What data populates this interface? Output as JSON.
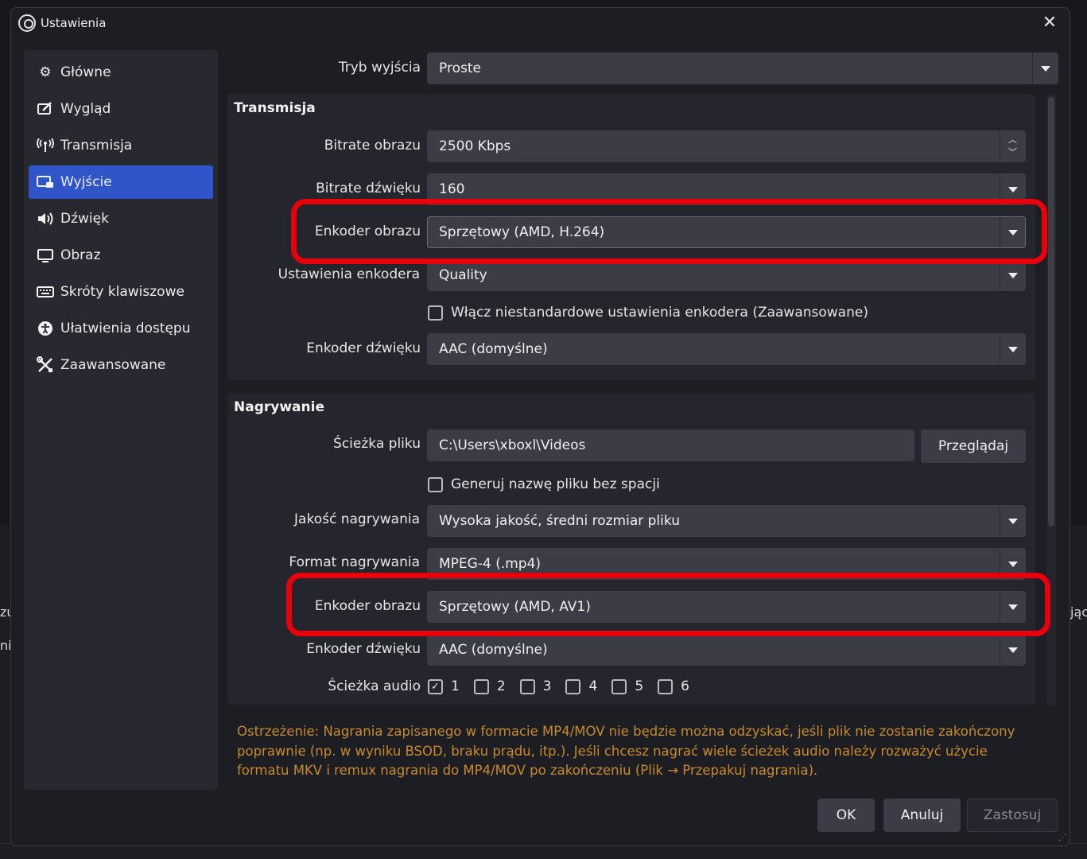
{
  "background": {
    "left_text_1": "zu",
    "left_text_2": "nie",
    "right_text": "jąc"
  },
  "window": {
    "title": "Ustawienia",
    "close_glyph": "✕"
  },
  "sidebar": {
    "items": [
      {
        "label": "Główne",
        "icon": "gear-icon"
      },
      {
        "label": "Wygląd",
        "icon": "appearance-icon"
      },
      {
        "label": "Transmisja",
        "icon": "antenna-icon"
      },
      {
        "label": "Wyjście",
        "icon": "output-icon"
      },
      {
        "label": "Dźwięk",
        "icon": "speaker-icon"
      },
      {
        "label": "Obraz",
        "icon": "monitor-icon"
      },
      {
        "label": "Skróty klawiszowe",
        "icon": "keyboard-icon"
      },
      {
        "label": "Ułatwienia dostępu",
        "icon": "accessibility-icon"
      },
      {
        "label": "Zaawansowane",
        "icon": "tools-icon"
      }
    ],
    "active": "Wyjście"
  },
  "output_mode": {
    "label": "Tryb wyjścia",
    "value": "Proste"
  },
  "streaming": {
    "title": "Transmisja",
    "video_bitrate": {
      "label": "Bitrate obrazu",
      "value": "2500 Kbps"
    },
    "audio_bitrate": {
      "label": "Bitrate dźwięku",
      "value": "160"
    },
    "video_encoder": {
      "label": "Enkoder obrazu",
      "value": "Sprzętowy (AMD, H.264)"
    },
    "encoder_preset": {
      "label": "Ustawienia enkodera",
      "value": "Quality"
    },
    "custom_settings": {
      "label": "Włącz niestandardowe ustawienia enkodera (Zaawansowane)",
      "checked": false
    },
    "audio_encoder": {
      "label": "Enkoder dźwięku",
      "value": "AAC (domyślne)"
    }
  },
  "recording": {
    "title": "Nagrywanie",
    "path": {
      "label": "Ścieżka pliku",
      "value": "C:\\Users\\xboxl\\Videos",
      "browse": "Przeglądaj"
    },
    "no_spaces": {
      "label": "Generuj nazwę pliku bez spacji",
      "checked": false
    },
    "quality": {
      "label": "Jakość nagrywania",
      "value": "Wysoka jakość, średni rozmiar pliku"
    },
    "format": {
      "label": "Format nagrywania",
      "value": "MPEG-4 (.mp4)"
    },
    "video_encoder": {
      "label": "Enkoder obrazu",
      "value": "Sprzętowy (AMD, AV1)"
    },
    "audio_encoder": {
      "label": "Enkoder dźwięku",
      "value": "AAC (domyślne)"
    },
    "audio_tracks": {
      "label": "Ścieżka audio",
      "tracks": [
        {
          "n": "1",
          "checked": true
        },
        {
          "n": "2",
          "checked": false
        },
        {
          "n": "3",
          "checked": false
        },
        {
          "n": "4",
          "checked": false
        },
        {
          "n": "5",
          "checked": false
        },
        {
          "n": "6",
          "checked": false
        }
      ]
    }
  },
  "warning": "Ostrzeżenie: Nagrania zapisanego w formacie MP4/MOV nie będzie można odzyskać, jeśli plik nie zostanie zakończony poprawnie (np. w wyniku BSOD, braku prądu, itp.). Jeśli chcesz nagrać wiele ścieżek audio należy rozważyć użycie formatu MKV i remux nagrania do MP4/MOV po zakończeniu (Plik → Przepakuj nagrania).",
  "buttons": {
    "ok": "OK",
    "cancel": "Anuluj",
    "apply": "Zastosuj"
  },
  "colors": {
    "accent": "#2f55c9",
    "highlight": "#e8000b",
    "warning": "#c88a2a"
  }
}
